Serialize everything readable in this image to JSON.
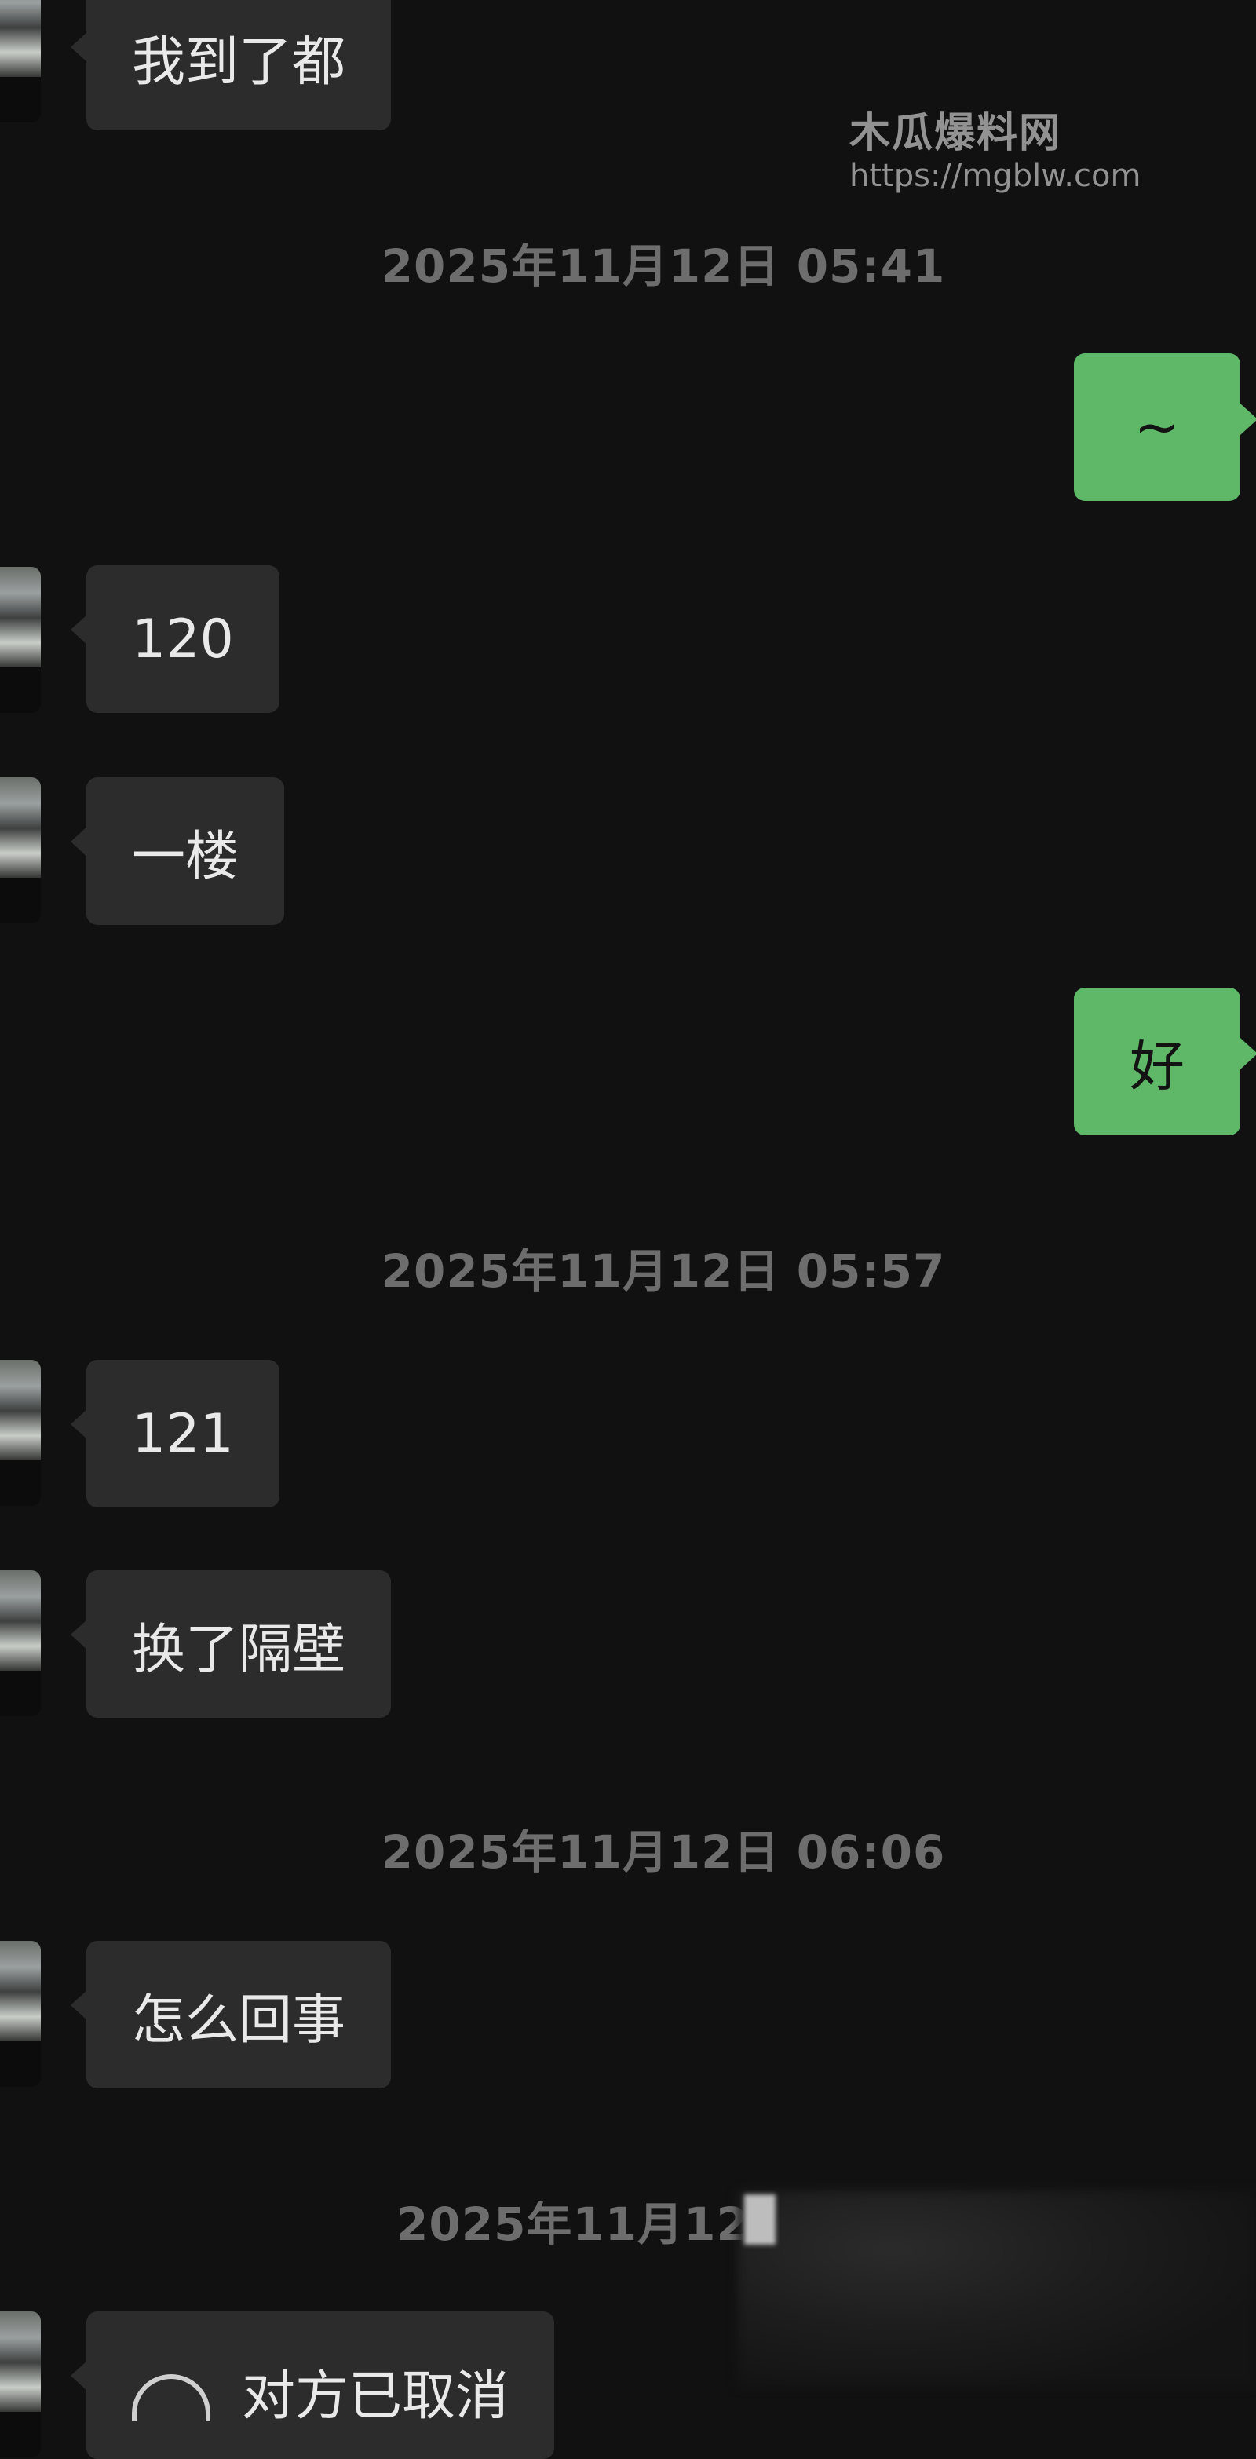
{
  "watermark": {
    "name": "木瓜爆料网",
    "url": "https://mgblw.com"
  },
  "messages": [
    {
      "side": "in",
      "text": "我到了都"
    },
    {
      "side": "out",
      "text": "~"
    },
    {
      "side": "in",
      "text": "120"
    },
    {
      "side": "in",
      "text": "一楼"
    },
    {
      "side": "out",
      "text": "好"
    },
    {
      "side": "in",
      "text": "121"
    },
    {
      "side": "in",
      "text": "换了隔壁"
    },
    {
      "side": "in",
      "text": "怎么回事"
    },
    {
      "side": "in",
      "text": "对方已取消",
      "icon": "call-cancel-icon"
    }
  ],
  "timestamps": [
    "2025年11月12日 05:41",
    "2025年11月12日 05:57",
    "2025年11月12日 06:06",
    "2025年11月12"
  ]
}
